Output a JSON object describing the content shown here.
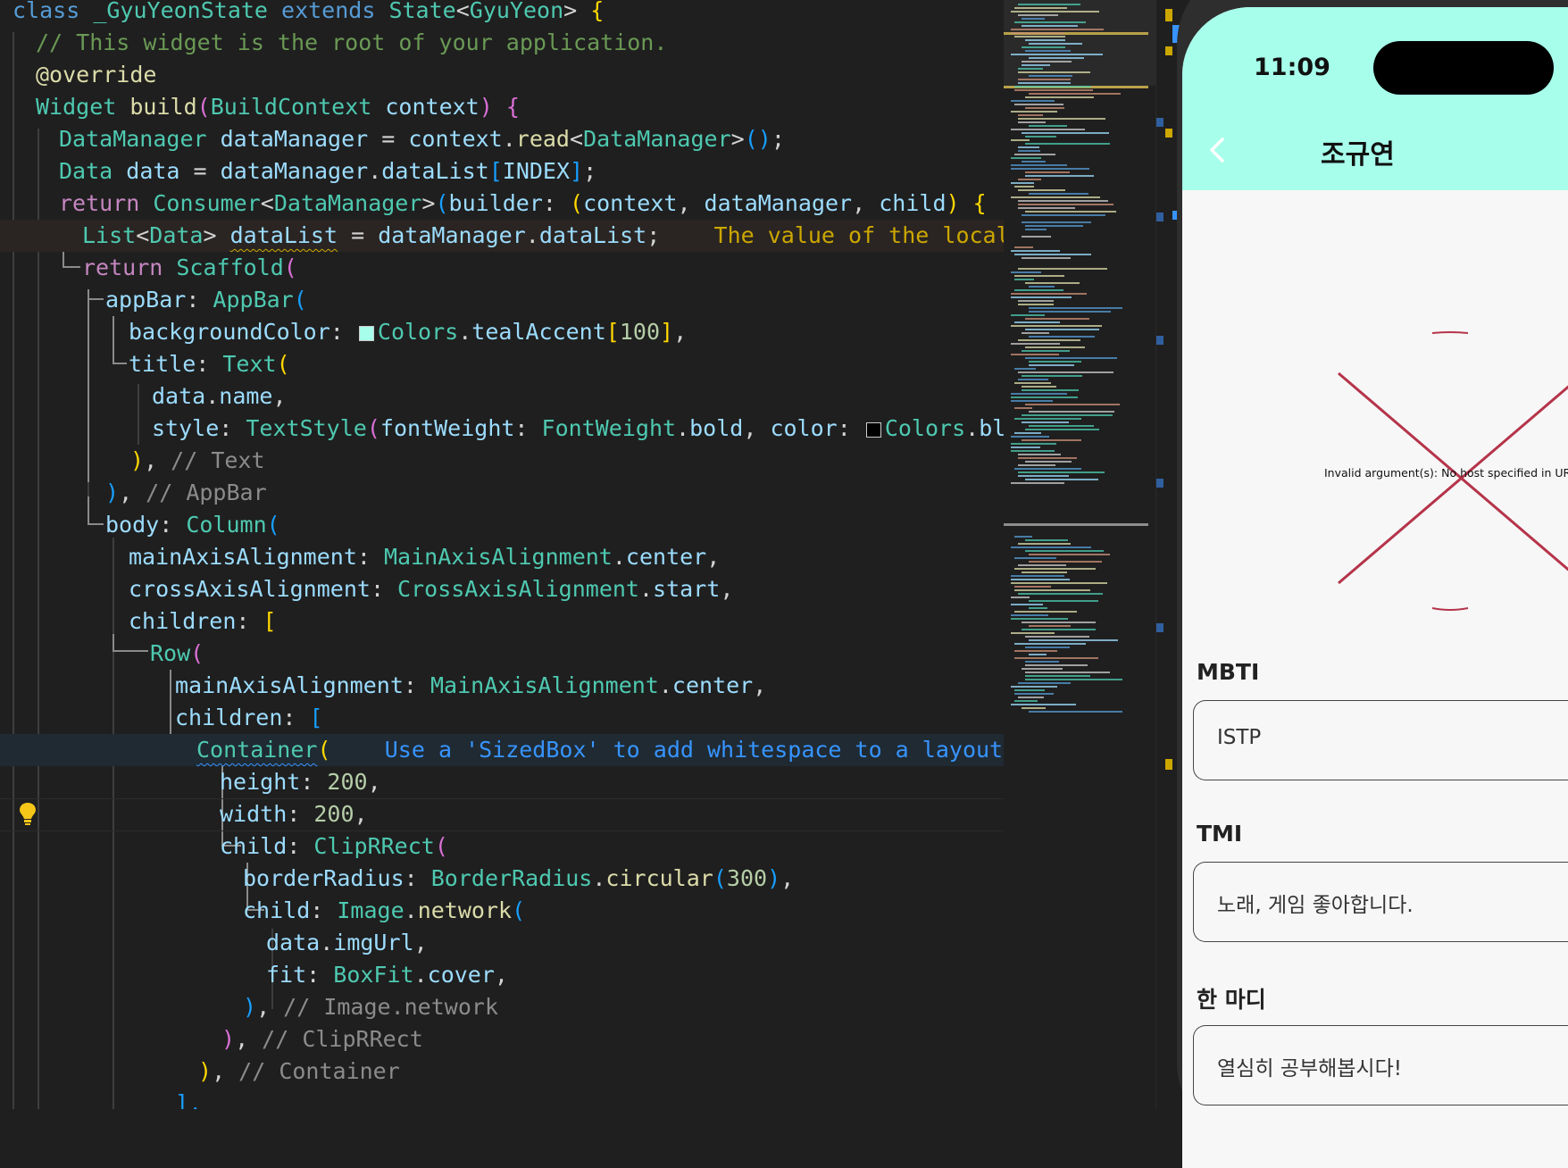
{
  "editor": {
    "lines": [
      {
        "tokens": [
          [
            "class ",
            "k"
          ],
          [
            "_GyuYeonState ",
            "c"
          ],
          [
            "extends ",
            "k"
          ],
          [
            "State",
            "c"
          ],
          [
            "<",
            "o"
          ],
          [
            "GyuYeon",
            "c"
          ],
          [
            "> ",
            "o"
          ],
          [
            "{",
            "b1"
          ]
        ]
      },
      {
        "tokens": [
          [
            "// This widget is the root of your application.",
            "cm"
          ]
        ]
      },
      {
        "tokens": [
          [
            "@override",
            "f"
          ]
        ]
      },
      {
        "tokens": [
          [
            "Widget ",
            "c"
          ],
          [
            "build",
            "f"
          ],
          [
            "(",
            "b2"
          ],
          [
            "BuildContext ",
            "c"
          ],
          [
            "context",
            "v"
          ],
          [
            ") ",
            "b2"
          ],
          [
            "{",
            "b2"
          ]
        ]
      },
      {
        "tokens": [
          [
            "DataManager ",
            "c"
          ],
          [
            "dataManager ",
            "v"
          ],
          [
            "= ",
            "o"
          ],
          [
            "context",
            "v"
          ],
          [
            ".",
            "o"
          ],
          [
            "read",
            "f"
          ],
          [
            "<",
            "o"
          ],
          [
            "DataManager",
            "c"
          ],
          [
            ">",
            "o"
          ],
          [
            "()",
            "b3"
          ],
          [
            ";",
            "o"
          ]
        ]
      },
      {
        "tokens": [
          [
            "Data ",
            "c"
          ],
          [
            "data ",
            "v"
          ],
          [
            "= ",
            "o"
          ],
          [
            "dataManager",
            "v"
          ],
          [
            ".",
            "o"
          ],
          [
            "dataList",
            "v"
          ],
          [
            "[",
            "b3"
          ],
          [
            "INDEX",
            "v"
          ],
          [
            "]",
            "b3"
          ],
          [
            ";",
            "o"
          ]
        ]
      },
      {
        "tokens": [
          [
            "return ",
            "ctl"
          ],
          [
            "Consumer",
            "c"
          ],
          [
            "<",
            "o"
          ],
          [
            "DataManager",
            "c"
          ],
          [
            ">",
            "o"
          ],
          [
            "(",
            "b3"
          ],
          [
            "builder",
            "v"
          ],
          [
            ": ",
            "o"
          ],
          [
            "(",
            "b1"
          ],
          [
            "context",
            "v"
          ],
          [
            ", ",
            "o"
          ],
          [
            "dataManager",
            "v"
          ],
          [
            ", ",
            "o"
          ],
          [
            "child",
            "v"
          ],
          [
            ") ",
            "b1"
          ],
          [
            "{",
            "b1"
          ]
        ]
      },
      {
        "tokens": [
          [
            "List",
            "c"
          ],
          [
            "<",
            "o"
          ],
          [
            "Data",
            "c"
          ],
          [
            "> ",
            "o"
          ],
          [
            "dataList",
            "v sq"
          ],
          [
            " = ",
            "o"
          ],
          [
            "dataManager",
            "v"
          ],
          [
            ".",
            "o"
          ],
          [
            "dataList",
            "v"
          ],
          [
            ";",
            "o"
          ],
          [
            "    The value of the local v",
            "hint-warn"
          ]
        ]
      },
      {
        "tokens": [
          [
            "return ",
            "ctl"
          ],
          [
            "Scaffold",
            "c"
          ],
          [
            "(",
            "b2"
          ]
        ]
      },
      {
        "tokens": [
          [
            "appBar",
            "v"
          ],
          [
            ": ",
            "o"
          ],
          [
            "AppBar",
            "c"
          ],
          [
            "(",
            "b3"
          ]
        ]
      },
      {
        "tokens": [
          [
            "backgroundColor",
            "v"
          ],
          [
            ": ",
            "o"
          ],
          [
            "SWATCH_TEAL",
            "swatch"
          ],
          [
            "Colors",
            "c"
          ],
          [
            ".",
            "o"
          ],
          [
            "tealAccent",
            "v"
          ],
          [
            "[",
            "b1"
          ],
          [
            "100",
            "n"
          ],
          [
            "]",
            "b1"
          ],
          [
            ",",
            "o"
          ]
        ]
      },
      {
        "tokens": [
          [
            "title",
            "v"
          ],
          [
            ": ",
            "o"
          ],
          [
            "Text",
            "c"
          ],
          [
            "(",
            "b1"
          ]
        ]
      },
      {
        "tokens": [
          [
            "data",
            "v"
          ],
          [
            ".",
            "o"
          ],
          [
            "name",
            "v"
          ],
          [
            ",",
            "o"
          ]
        ]
      },
      {
        "tokens": [
          [
            "style",
            "v"
          ],
          [
            ": ",
            "o"
          ],
          [
            "TextStyle",
            "c"
          ],
          [
            "(",
            "b2"
          ],
          [
            "fontWeight",
            "v"
          ],
          [
            ": ",
            "o"
          ],
          [
            "FontWeight",
            "c"
          ],
          [
            ".",
            "o"
          ],
          [
            "bold",
            "v"
          ],
          [
            ", ",
            "o"
          ],
          [
            "color",
            "v"
          ],
          [
            ": ",
            "o"
          ],
          [
            "SWATCH_BLACK",
            "swatch"
          ],
          [
            "Colors",
            "c"
          ],
          [
            ".",
            "o"
          ],
          [
            "bla",
            "v"
          ]
        ]
      },
      {
        "tokens": [
          [
            ")",
            "b1"
          ],
          [
            ", ",
            "o"
          ],
          [
            "// Text",
            "ccm"
          ]
        ]
      },
      {
        "tokens": [
          [
            ")",
            "b3"
          ],
          [
            ", ",
            "o"
          ],
          [
            "// AppBar",
            "ccm"
          ]
        ]
      },
      {
        "tokens": [
          [
            "body",
            "v"
          ],
          [
            ": ",
            "o"
          ],
          [
            "Column",
            "c"
          ],
          [
            "(",
            "b3"
          ]
        ]
      },
      {
        "tokens": [
          [
            "mainAxisAlignment",
            "v"
          ],
          [
            ": ",
            "o"
          ],
          [
            "MainAxisAlignment",
            "c"
          ],
          [
            ".",
            "o"
          ],
          [
            "center",
            "v"
          ],
          [
            ",",
            "o"
          ]
        ]
      },
      {
        "tokens": [
          [
            "crossAxisAlignment",
            "v"
          ],
          [
            ": ",
            "o"
          ],
          [
            "CrossAxisAlignment",
            "c"
          ],
          [
            ".",
            "o"
          ],
          [
            "start",
            "v"
          ],
          [
            ",",
            "o"
          ]
        ]
      },
      {
        "tokens": [
          [
            "children",
            "v"
          ],
          [
            ": ",
            "o"
          ],
          [
            "[",
            "b1"
          ]
        ]
      },
      {
        "tokens": [
          [
            "Row",
            "c"
          ],
          [
            "(",
            "b2"
          ]
        ]
      },
      {
        "tokens": [
          [
            "mainAxisAlignment",
            "v"
          ],
          [
            ": ",
            "o"
          ],
          [
            "MainAxisAlignment",
            "c"
          ],
          [
            ".",
            "o"
          ],
          [
            "center",
            "v"
          ],
          [
            ",",
            "o"
          ]
        ]
      },
      {
        "tokens": [
          [
            "children",
            "v"
          ],
          [
            ": ",
            "o"
          ],
          [
            "[",
            "b3"
          ]
        ]
      },
      {
        "tokens": [
          [
            "Container",
            "c sqb"
          ],
          [
            "(",
            "b1"
          ],
          [
            "    Use a 'SizedBox' to add whitespace to a layout.",
            "hint-info"
          ]
        ]
      },
      {
        "tokens": [
          [
            "height",
            "v"
          ],
          [
            ": ",
            "o"
          ],
          [
            "200",
            "n"
          ],
          [
            ",",
            "o"
          ]
        ]
      },
      {
        "tokens": [
          [
            "width",
            "v"
          ],
          [
            ": ",
            "o"
          ],
          [
            "200",
            "n"
          ],
          [
            ",",
            "o"
          ]
        ]
      },
      {
        "tokens": [
          [
            "child",
            "v"
          ],
          [
            ": ",
            "o"
          ],
          [
            "ClipRRect",
            "c"
          ],
          [
            "(",
            "b2"
          ]
        ]
      },
      {
        "tokens": [
          [
            "borderRadius",
            "v"
          ],
          [
            ": ",
            "o"
          ],
          [
            "BorderRadius",
            "c"
          ],
          [
            ".",
            "o"
          ],
          [
            "circular",
            "f"
          ],
          [
            "(",
            "b3"
          ],
          [
            "300",
            "n"
          ],
          [
            ")",
            "b3"
          ],
          [
            ",",
            "o"
          ]
        ]
      },
      {
        "tokens": [
          [
            "child",
            "v"
          ],
          [
            ": ",
            "o"
          ],
          [
            "Image",
            "c"
          ],
          [
            ".",
            "o"
          ],
          [
            "network",
            "f"
          ],
          [
            "(",
            "b3"
          ]
        ]
      },
      {
        "tokens": [
          [
            "data",
            "v"
          ],
          [
            ".",
            "o"
          ],
          [
            "imgUrl",
            "v"
          ],
          [
            ",",
            "o"
          ]
        ]
      },
      {
        "tokens": [
          [
            "fit",
            "v"
          ],
          [
            ": ",
            "o"
          ],
          [
            "BoxFit",
            "c"
          ],
          [
            ".",
            "o"
          ],
          [
            "cover",
            "v"
          ],
          [
            ",",
            "o"
          ]
        ]
      },
      {
        "tokens": [
          [
            ")",
            "b3"
          ],
          [
            ", ",
            "o"
          ],
          [
            "// Image.network",
            "ccm"
          ]
        ]
      },
      {
        "tokens": [
          [
            ")",
            "b2"
          ],
          [
            ", ",
            "o"
          ],
          [
            "// ClipRRect",
            "ccm"
          ]
        ]
      },
      {
        "tokens": [
          [
            ")",
            "b1"
          ],
          [
            ", ",
            "o"
          ],
          [
            "// Container",
            "ccm"
          ]
        ]
      },
      {
        "tokens": [
          [
            "],",
            "b3"
          ]
        ]
      }
    ]
  },
  "colors": {
    "editor_bg": "#1f1f1f",
    "appbar_bg": "#a7ffeb",
    "teal_swatch": "#a7ffeb",
    "error_cross": "#b5344a"
  },
  "phone": {
    "status_time": "11:09",
    "back_icon": "chevron-left-icon",
    "title": "조규연",
    "image_error": "Invalid argument(s): No host specified in URI",
    "fields": [
      {
        "label": "MBTI",
        "value": "ISTP"
      },
      {
        "label": "TMI",
        "value": "노래, 게임 좋아합니다."
      },
      {
        "label": "한 마디",
        "value": "열심히 공부해봅시다!"
      }
    ]
  }
}
